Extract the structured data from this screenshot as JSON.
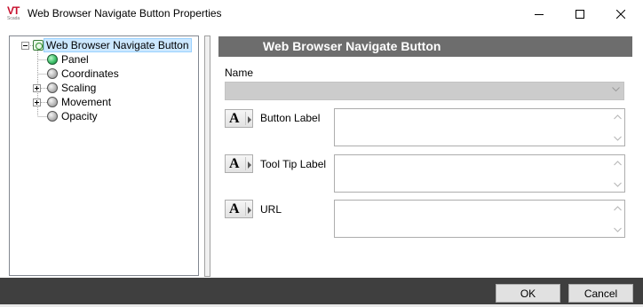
{
  "window": {
    "title": "Web Browser Navigate Button Properties",
    "logo_text": "VT",
    "logo_subtext": "Scada"
  },
  "tree": {
    "root_label": "Web Browser Navigate Button",
    "items": [
      {
        "label": "Panel",
        "status": "green",
        "expandable": false
      },
      {
        "label": "Coordinates",
        "status": "gray",
        "expandable": false
      },
      {
        "label": "Scaling",
        "status": "gray",
        "expandable": true
      },
      {
        "label": "Movement",
        "status": "gray",
        "expandable": true
      },
      {
        "label": "Opacity",
        "status": "gray",
        "expandable": false
      }
    ]
  },
  "panel": {
    "header": "Web Browser Navigate Button",
    "name_label": "Name",
    "name_value": "",
    "fields": [
      {
        "label": "Button Label",
        "value": ""
      },
      {
        "label": "Tool Tip Label",
        "value": ""
      },
      {
        "label": "URL",
        "value": ""
      }
    ]
  },
  "footer": {
    "ok_label": "OK",
    "cancel_label": "Cancel"
  },
  "colors": {
    "header_bg": "#6d6d6d",
    "footer_bg": "#3f3f3f",
    "selection_bg": "#cce8ff",
    "logo_red": "#c8102e"
  }
}
